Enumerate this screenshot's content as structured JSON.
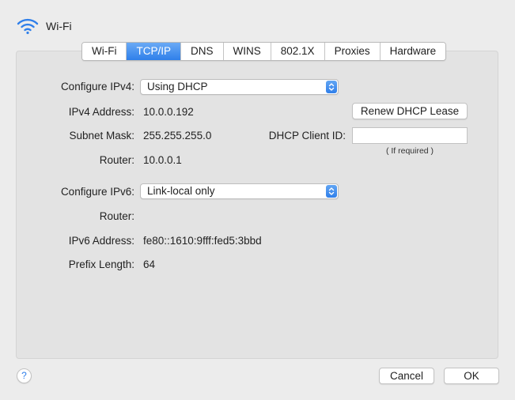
{
  "header": {
    "icon": "wifi-icon",
    "title": "Wi-Fi"
  },
  "tabs": [
    {
      "label": "Wi-Fi",
      "active": false
    },
    {
      "label": "TCP/IP",
      "active": true
    },
    {
      "label": "DNS",
      "active": false
    },
    {
      "label": "WINS",
      "active": false
    },
    {
      "label": "802.1X",
      "active": false
    },
    {
      "label": "Proxies",
      "active": false
    },
    {
      "label": "Hardware",
      "active": false
    }
  ],
  "ipv4": {
    "configure_label": "Configure IPv4:",
    "configure_value": "Using DHCP",
    "address_label": "IPv4 Address:",
    "address_value": "10.0.0.192",
    "subnet_label": "Subnet Mask:",
    "subnet_value": "255.255.255.0",
    "router_label": "Router:",
    "router_value": "10.0.0.1",
    "renew_button": "Renew DHCP Lease",
    "client_id_label": "DHCP Client ID:",
    "client_id_value": "",
    "client_id_hint": "( If required )"
  },
  "ipv6": {
    "configure_label": "Configure IPv6:",
    "configure_value": "Link-local only",
    "router_label": "Router:",
    "router_value": "",
    "address_label": "IPv6 Address:",
    "address_value": "fe80::1610:9fff:fed5:3bbd",
    "prefix_label": "Prefix Length:",
    "prefix_value": "64"
  },
  "footer": {
    "help": "?",
    "cancel": "Cancel",
    "ok": "OK"
  },
  "colors": {
    "accent": "#2f7fea",
    "background": "#ececec",
    "panel": "#e3e3e3"
  }
}
